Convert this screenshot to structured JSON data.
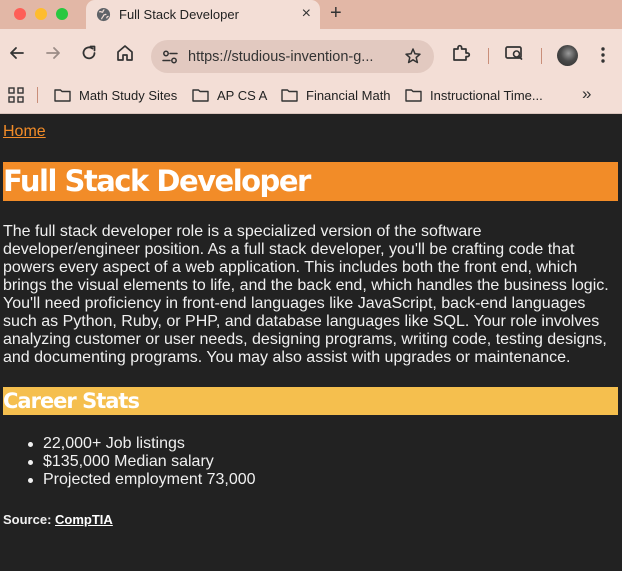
{
  "browser": {
    "tab_title": "Full Stack Developer",
    "new_tab_symbol": "+",
    "close_symbol": "×",
    "url": "https://studious-invention-g...",
    "bookmarks": [
      {
        "label": "Math Study Sites"
      },
      {
        "label": "AP CS A"
      },
      {
        "label": "Financial Math"
      },
      {
        "label": "Instructional Time..."
      }
    ],
    "more_bookmarks_symbol": "»"
  },
  "page": {
    "home_link": "Home",
    "title": "Full Stack Developer",
    "intro": "The full stack developer role is a specialized version of the software developer/engineer position. As a full stack developer, you'll be crafting code that powers every aspect of a web application. This includes both the front end, which brings the visual elements to life, and the back end, which handles the business logic. You'll need proficiency in front-end languages like JavaScript, back-end languages such as Python, Ruby, or PHP, and database languages like SQL. Your role involves analyzing customer or user needs, designing programs, writing code, testing designs, and documenting programs. You may also assist with upgrades or maintenance.",
    "stats_heading": "Career Stats",
    "stats": [
      "22,000+ Job listings",
      "$135,000 Median salary",
      "Projected employment 73,000"
    ],
    "source_label": "Source:",
    "source_link": "CompTIA"
  },
  "colors": {
    "page_background": "#222222",
    "h1_bar": "#f28c28",
    "h2_bar": "#f5bf4e",
    "link": "#f28c28",
    "chrome_tabbar": "#e2b7a6",
    "chrome_toolbar": "#f3ded6"
  }
}
